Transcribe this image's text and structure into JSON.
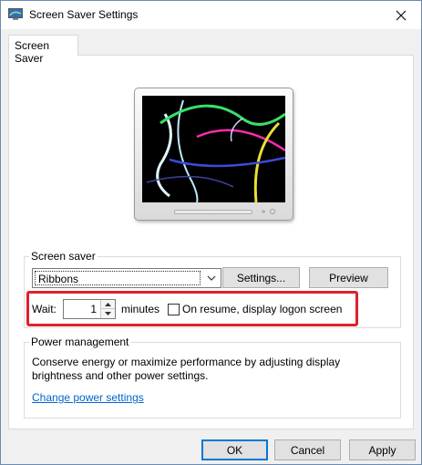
{
  "window": {
    "title": "Screen Saver Settings",
    "app_icon": "screen-saver-settings-icon",
    "close_icon": "close-icon"
  },
  "tabs": [
    {
      "label": "Screen Saver",
      "selected": true
    }
  ],
  "preview": {
    "saver_shown": "Ribbons"
  },
  "screen_saver_group": {
    "label": "Screen saver",
    "selected_saver": "Ribbons",
    "dropdown_icon": "chevron-down-icon",
    "settings_button": "Settings...",
    "preview_button": "Preview",
    "wait_label": "Wait:",
    "wait_value": "1",
    "minutes_label": "minutes",
    "resume_checkbox_label": "On resume, display logon screen",
    "resume_checked": false,
    "highlight_color": "#e0202a"
  },
  "power_group": {
    "label": "Power management",
    "description_line1": "Conserve energy or maximize performance by adjusting display",
    "description_line2": "brightness and other power settings.",
    "link": "Change power settings"
  },
  "footer": {
    "ok": "OK",
    "cancel": "Cancel",
    "apply": "Apply"
  }
}
